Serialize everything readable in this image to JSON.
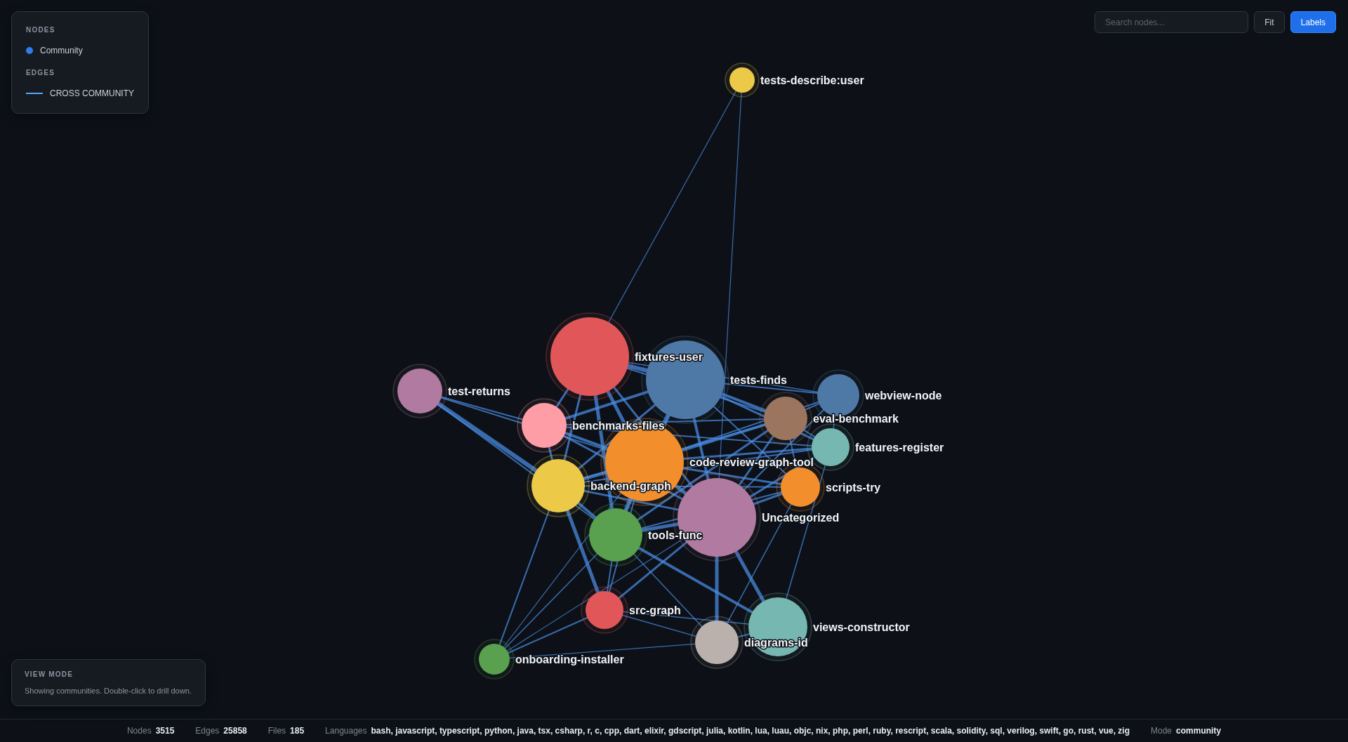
{
  "legend": {
    "sections": [
      {
        "heading": "NODES",
        "items": [
          {
            "kind": "dot",
            "label": "Community",
            "color": "#2f7bf0"
          }
        ]
      },
      {
        "heading": "EDGES",
        "items": [
          {
            "kind": "line",
            "label": "CROSS COMMUNITY",
            "color": "#58a6ff"
          }
        ]
      }
    ]
  },
  "toolbar": {
    "search": {
      "placeholder": "Search nodes..."
    },
    "buttons": [
      {
        "label": "Fit",
        "active": false
      },
      {
        "label": "Labels",
        "active": true
      }
    ]
  },
  "graph": {
    "nodes": [
      {
        "label": "tests-describe:user",
        "color": "#edc948"
      },
      {
        "label": "fixtures-user",
        "color": "#e15759"
      },
      {
        "label": "tests-finds",
        "color": "#4e79a7"
      },
      {
        "label": "test-returns",
        "color": "#b07aa1"
      },
      {
        "label": "webview-node",
        "color": "#4e79a7"
      },
      {
        "label": "benchmarks-files",
        "color": "#ff9da7"
      },
      {
        "label": "eval-benchmark",
        "color": "#9c755f"
      },
      {
        "label": "features-register",
        "color": "#76b7b2"
      },
      {
        "label": "code-review-graph-tool",
        "color": "#f28e2b"
      },
      {
        "label": "backend-graph",
        "color": "#edc948"
      },
      {
        "label": "scripts-try",
        "color": "#f28e2b"
      },
      {
        "label": "Uncategorized",
        "color": "#b07aa1"
      },
      {
        "label": "tools-func",
        "color": "#59a14f"
      },
      {
        "label": "src-graph",
        "color": "#e15759"
      },
      {
        "label": "views-constructor",
        "color": "#76b7b2"
      },
      {
        "label": "diagrams-id",
        "color": "#bab0ac"
      },
      {
        "label": "onboarding-installer",
        "color": "#59a14f"
      }
    ]
  },
  "view_mode": {
    "title": "VIEW MODE",
    "text": "Showing communities. Double-click to drill down."
  },
  "status_bar": {
    "items": [
      {
        "label": "Nodes",
        "value": "3515"
      },
      {
        "label": "Edges",
        "value": "25858"
      },
      {
        "label": "Files",
        "value": "185"
      },
      {
        "label": "Languages",
        "value": "bash, javascript, typescript, python, java, tsx, csharp, r, c, cpp, dart, elixir, gdscript, julia, kotlin, lua, luau, objc, nix, php, perl, ruby, rescript, scala, solidity, sql, verilog, swift, go, rust, vue, zig"
      },
      {
        "label": "Mode",
        "value": "community"
      }
    ]
  }
}
